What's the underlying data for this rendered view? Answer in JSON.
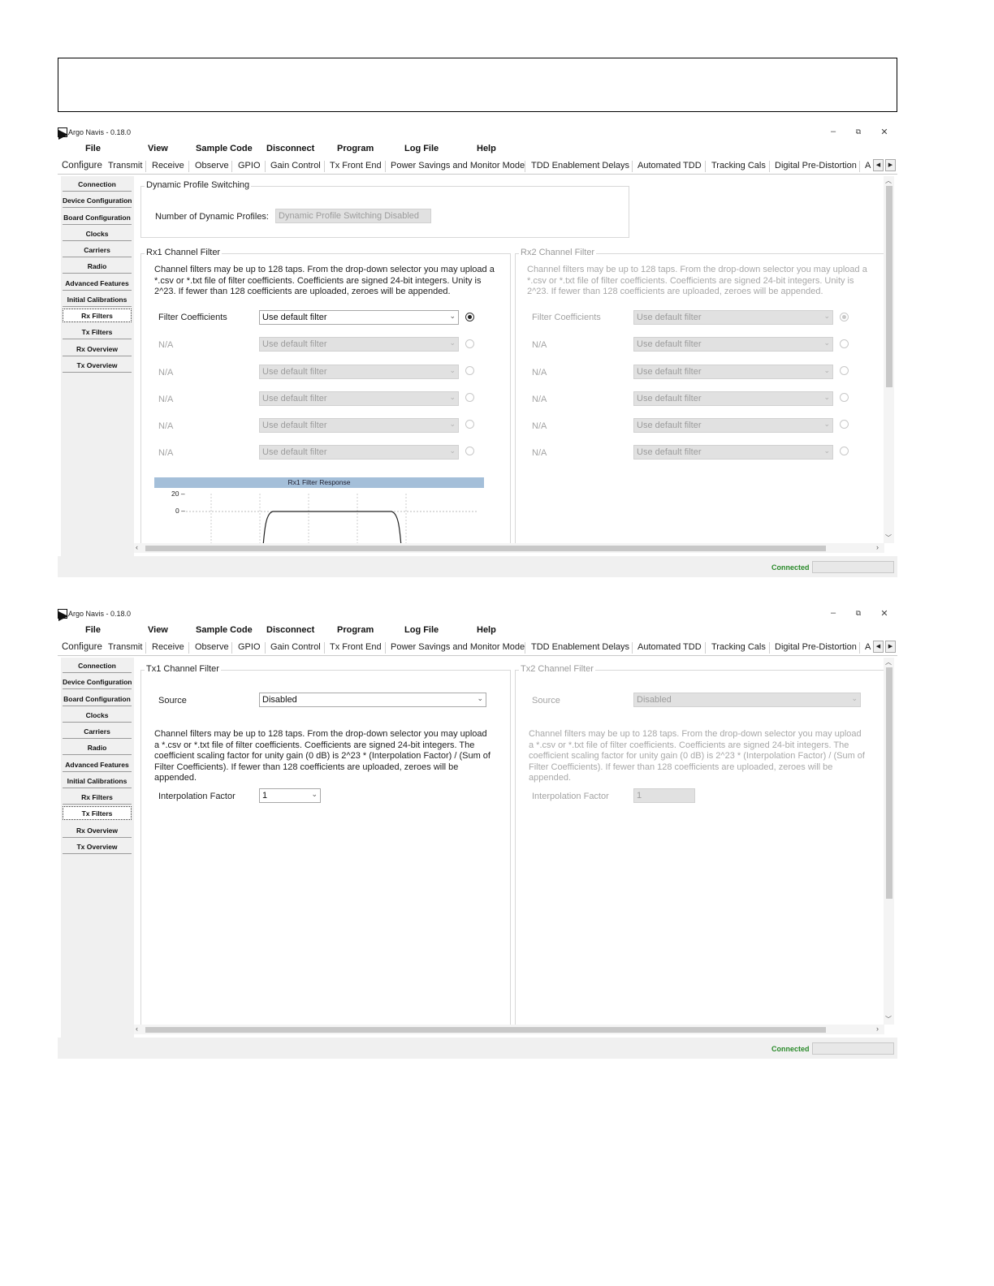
{
  "windows": [
    {
      "app_title": "Argo Navis - 0.18.0",
      "menu": [
        "File",
        "View",
        "Sample Code",
        "Disconnect",
        "Program",
        "Log File",
        "Help"
      ],
      "tabs": [
        "Configure",
        "Transmit",
        "Receive",
        "Observe",
        "GPIO",
        "Gain Control",
        "Tx Front End",
        "Power Savings and Monitor Mode",
        "TDD Enablement Delays",
        "Automated TDD",
        "Tracking Cals",
        "Digital Pre-Distortion",
        "A"
      ],
      "active_tab": "Configure",
      "sidebar": [
        "Connection",
        "Device Configuration",
        "Board Configuration",
        "Clocks",
        "Carriers",
        "Radio",
        "Advanced Features",
        "Initial Calibrations",
        "Rx Filters",
        "Tx Filters",
        "Rx Overview",
        "Tx Overview"
      ],
      "selected_sidebar": "Rx Filters",
      "dps": {
        "title": "Dynamic Profile Switching",
        "label": "Number of Dynamic Profiles:",
        "value": "Dynamic Profile Switching Disabled"
      },
      "rx1": {
        "title": "Rx1 Channel Filter",
        "desc": "Channel filters may be up to 128 taps. From the drop-down selector you may upload a *.csv or *.txt file of filter coefficients. Coefficients are signed 24-bit integers. Unity is 2^23. If fewer than 128 coefficients are uploaded, zeroes will be appended.",
        "rows": [
          {
            "label": "Filter Coefficients",
            "value": "Use default filter",
            "selected": true
          },
          {
            "label": "N/A",
            "value": "Use default filter",
            "selected": false
          },
          {
            "label": "N/A",
            "value": "Use default filter",
            "selected": false
          },
          {
            "label": "N/A",
            "value": "Use default filter",
            "selected": false
          },
          {
            "label": "N/A",
            "value": "Use default filter",
            "selected": false
          },
          {
            "label": "N/A",
            "value": "Use default filter",
            "selected": false
          }
        ],
        "chart_title": "Rx1 Filter Response",
        "chart_ticks": [
          "20 –",
          "0 –"
        ]
      },
      "rx2": {
        "title": "Rx2 Channel Filter",
        "desc": "Channel filters may be up to 128 taps. From the drop-down selector you may upload a *.csv or *.txt file of filter coefficients. Coefficients are signed 24-bit integers. Unity is 2^23. If fewer than 128 coefficients are uploaded, zeroes will be appended.",
        "rows": [
          {
            "label": "Filter Coefficients",
            "value": "Use default filter",
            "selected": true
          },
          {
            "label": "N/A",
            "value": "Use default filter",
            "selected": false
          },
          {
            "label": "N/A",
            "value": "Use default filter",
            "selected": false
          },
          {
            "label": "N/A",
            "value": "Use default filter",
            "selected": false
          },
          {
            "label": "N/A",
            "value": "Use default filter",
            "selected": false
          },
          {
            "label": "N/A",
            "value": "Use default filter",
            "selected": false
          }
        ]
      },
      "status": "Connected"
    },
    {
      "app_title": "Argo Navis - 0.18.0",
      "menu": [
        "File",
        "View",
        "Sample Code",
        "Disconnect",
        "Program",
        "Log File",
        "Help"
      ],
      "tabs": [
        "Configure",
        "Transmit",
        "Receive",
        "Observe",
        "GPIO",
        "Gain Control",
        "Tx Front End",
        "Power Savings and Monitor Mode",
        "TDD Enablement Delays",
        "Automated TDD",
        "Tracking Cals",
        "Digital Pre-Distortion",
        "A"
      ],
      "active_tab": "Configure",
      "sidebar": [
        "Connection",
        "Device Configuration",
        "Board Configuration",
        "Clocks",
        "Carriers",
        "Radio",
        "Advanced Features",
        "Initial Calibrations",
        "Rx Filters",
        "Tx Filters",
        "Rx Overview",
        "Tx Overview"
      ],
      "selected_sidebar": "Tx Filters",
      "tx1": {
        "title": "Tx1 Channel Filter",
        "source_label": "Source",
        "source_value": "Disabled",
        "desc": "Channel filters may be up to 128 taps. From the drop-down selector you may upload a *.csv or *.txt file of filter coefficients. Coefficients are signed 24-bit integers. The coefficient scaling factor for unity gain (0 dB) is 2^23 * (Interpolation Factor) / (Sum of Filter Coefficients). If fewer than 128 coefficients are uploaded, zeroes will be appended.",
        "interp_label": "Interpolation Factor",
        "interp_value": "1"
      },
      "tx2": {
        "title": "Tx2 Channel Filter",
        "source_label": "Source",
        "source_value": "Disabled",
        "desc": "Channel filters may be up to 128 taps. From the drop-down selector you may upload a *.csv or *.txt file of filter coefficients. Coefficients are signed 24-bit integers. The coefficient scaling factor for unity gain (0 dB) is 2^23 * (Interpolation Factor) / (Sum of Filter Coefficients). If fewer than 128 coefficients are uploaded, zeroes will be appended.",
        "interp_label": "Interpolation Factor",
        "interp_value": "1"
      },
      "status": "Connected"
    }
  ]
}
